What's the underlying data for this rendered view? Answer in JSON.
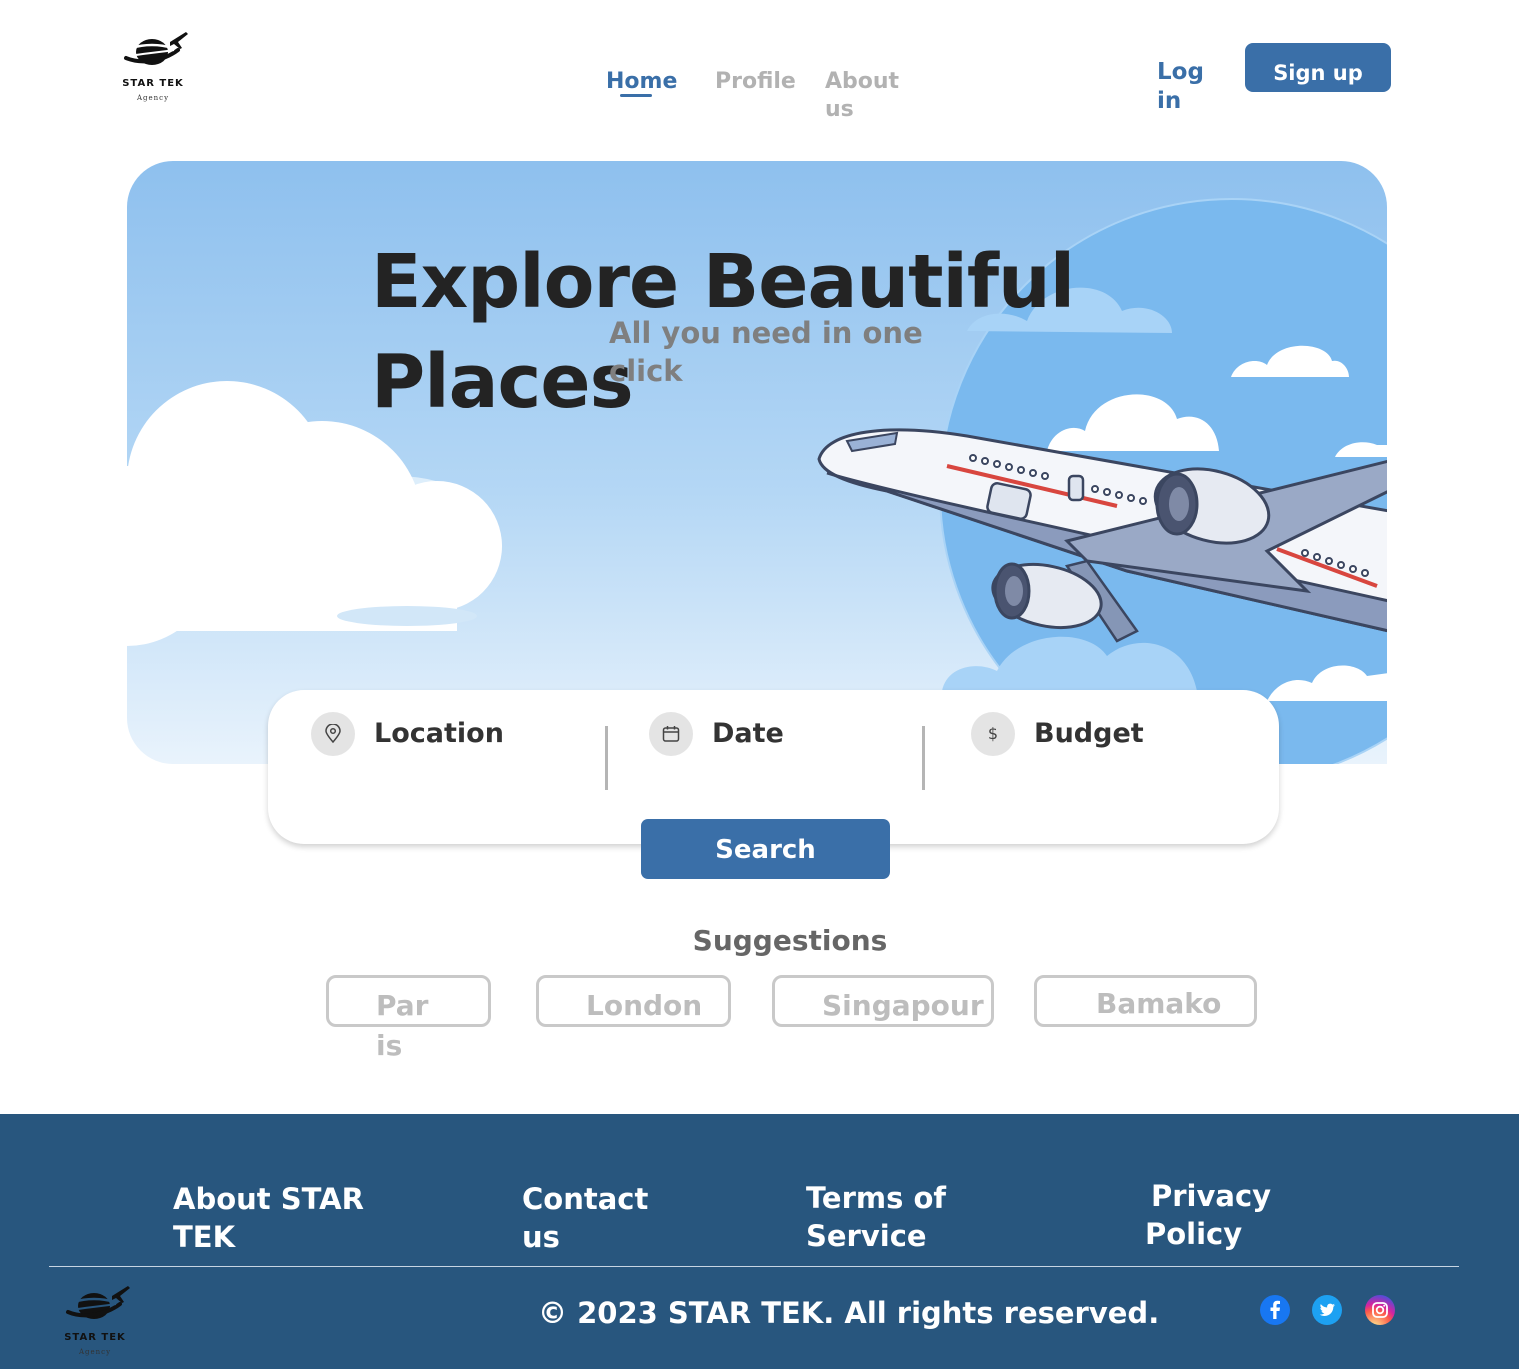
{
  "header": {
    "logo": {
      "brand": "STAR TEK",
      "sub": "Agency"
    },
    "nav": [
      {
        "label": "Home",
        "active": true
      },
      {
        "label": "Profile",
        "active": false
      },
      {
        "label": "About us",
        "active": false
      }
    ],
    "login_label": "Log in",
    "signup_label": "Sign up"
  },
  "hero": {
    "title": "Explore Beautiful Places",
    "tagline": "All you need in one click"
  },
  "search": {
    "fields": [
      {
        "label": "Location",
        "icon": "map-pin-icon"
      },
      {
        "label": "Date",
        "icon": "calendar-icon"
      },
      {
        "label": "Budget",
        "icon": "dollar-icon"
      }
    ],
    "button_label": "Search"
  },
  "suggestions": {
    "title": "Suggestions",
    "items": [
      "Paris",
      "London",
      "Singapour",
      "Bamako"
    ]
  },
  "footer": {
    "links": [
      "About STAR TEK",
      "Contact us",
      "Terms of Service",
      "Privacy Policy"
    ],
    "copyright": "© 2023 STAR TEK. All rights reserved.",
    "logo": {
      "brand": "STAR TEK",
      "sub": "Agency"
    },
    "social": [
      "facebook-icon",
      "twitter-icon",
      "instagram-icon"
    ]
  },
  "colors": {
    "accent": "#3a6fa8",
    "footer_bg": "#28567e",
    "nav_inactive": "#b2b2b2",
    "sky_top": "#8ec0ee"
  }
}
